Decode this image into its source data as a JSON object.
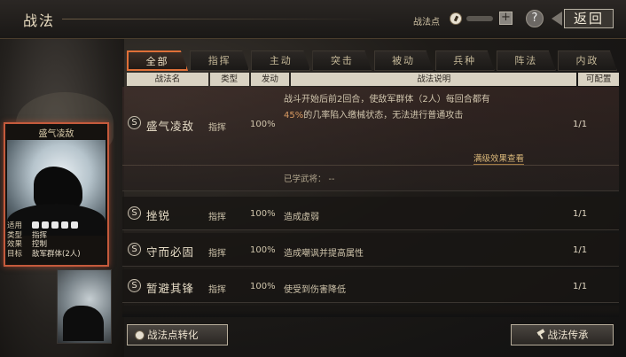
{
  "header": {
    "title": "战法",
    "points_label": "战法点",
    "help_label": "?",
    "back_label": "返回"
  },
  "card": {
    "title": "盛气凌敌",
    "rows": [
      {
        "k": "适用",
        "v": ""
      },
      {
        "k": "类型",
        "v": "指挥"
      },
      {
        "k": "效果",
        "v": "控制"
      },
      {
        "k": "目标",
        "v": "敌军群体(2人)"
      }
    ]
  },
  "tabs": [
    "全部",
    "指挥",
    "主动",
    "突击",
    "被动",
    "兵种",
    "阵法",
    "内政"
  ],
  "active_tab": 0,
  "columns": [
    "战法名",
    "类型",
    "发动",
    "战法说明",
    "可配置"
  ],
  "rows": [
    {
      "badge": "S",
      "name": "盛气凌敌",
      "type": "指挥",
      "rate": "100%",
      "desc_line1": "战斗开始后前2回合，使敌军群体（2人）每回合都有",
      "desc_line2_hl": "45%",
      "desc_line2_rest": "的几率陷入缴械状态，无法进行普通攻击",
      "view_full": "满级效果查看",
      "learned": "已学武将： --",
      "conf": "1/1"
    },
    {
      "badge": "S",
      "name": "挫锐",
      "type": "指挥",
      "rate": "100%",
      "desc": "造成虚弱",
      "conf": "1/1"
    },
    {
      "badge": "S",
      "name": "守而必固",
      "type": "指挥",
      "rate": "100%",
      "desc": "造成嘲讽并提高属性",
      "conf": "1/1"
    },
    {
      "badge": "S",
      "name": "暂避其锋",
      "type": "指挥",
      "rate": "100%",
      "desc": "使受到伤害降低",
      "conf": "1/1"
    }
  ],
  "buttons": {
    "convert": "战法点转化",
    "inherit": "战法传承"
  },
  "colors": {
    "accent": "#e07038",
    "card_border": "#c45a3c",
    "header_bg": "#d9d2c2"
  }
}
